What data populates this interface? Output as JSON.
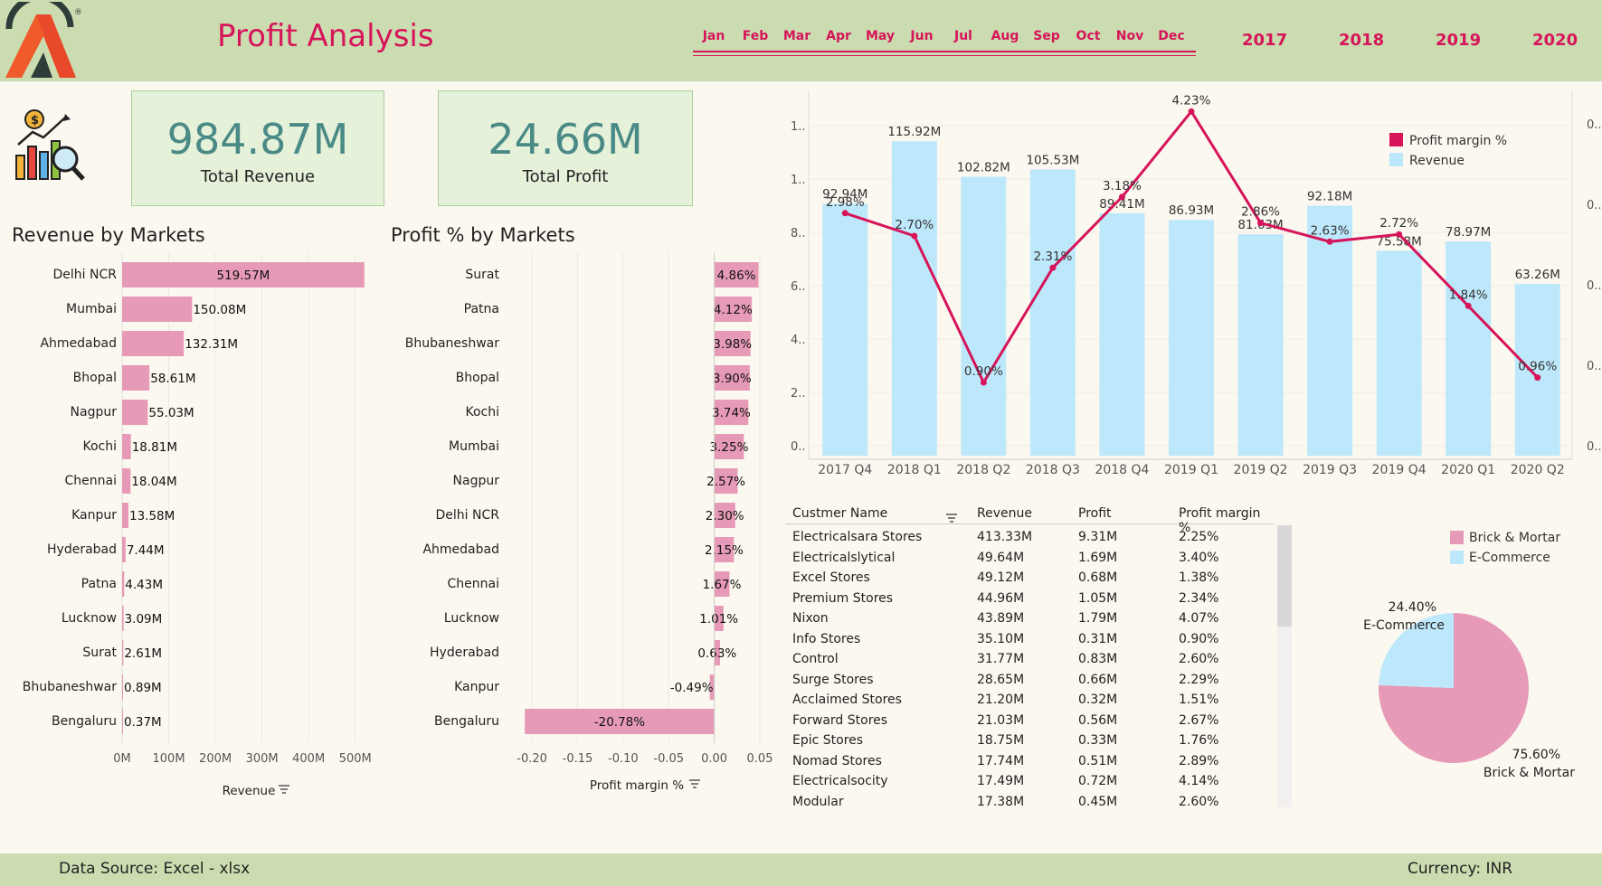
{
  "header": {
    "title": "Profit Analysis",
    "months": [
      "Jan",
      "Feb",
      "Mar",
      "Apr",
      "May",
      "Jun",
      "Jul",
      "Aug",
      "Sep",
      "Oct",
      "Nov",
      "Dec"
    ],
    "years": [
      "2017",
      "2018",
      "2019",
      "2020"
    ],
    "logo_mark": "®"
  },
  "kpis": {
    "revenue_value": "984.87M",
    "revenue_label": "Total Revenue",
    "profit_value": "24.66M",
    "profit_label": "Total Profit"
  },
  "sections": {
    "revenue_by_markets": "Revenue by Markets",
    "profit_by_markets": "Profit  % by Markets"
  },
  "footer": {
    "source": "Data Source:  Excel - xlsx",
    "currency": "Currency: INR"
  },
  "colors": {
    "accent": "#d6145a",
    "bar_pink": "#e79ab7",
    "bar_blue": "#bde8fb",
    "kpi_text": "#4a8a86",
    "header_bg": "#cbddb0"
  },
  "table": {
    "headers": [
      "Custmer Name",
      "Revenue",
      "Profit",
      "Profit margin %"
    ],
    "rows": [
      [
        "Electricalsara Stores",
        "413.33M",
        "9.31M",
        "2.25%"
      ],
      [
        "Electricalslytical",
        "49.64M",
        "1.69M",
        "3.40%"
      ],
      [
        "Excel Stores",
        "49.12M",
        "0.68M",
        "1.38%"
      ],
      [
        "Premium Stores",
        "44.96M",
        "1.05M",
        "2.34%"
      ],
      [
        "Nixon",
        "43.89M",
        "1.79M",
        "4.07%"
      ],
      [
        "Info Stores",
        "35.10M",
        "0.31M",
        "0.90%"
      ],
      [
        "Control",
        "31.77M",
        "0.83M",
        "2.60%"
      ],
      [
        "Surge Stores",
        "28.65M",
        "0.66M",
        "2.29%"
      ],
      [
        "Acclaimed Stores",
        "21.20M",
        "0.32M",
        "1.51%"
      ],
      [
        "Forward Stores",
        "21.03M",
        "0.56M",
        "2.67%"
      ],
      [
        "Epic Stores",
        "18.75M",
        "0.33M",
        "1.76%"
      ],
      [
        "Nomad Stores",
        "17.74M",
        "0.51M",
        "2.89%"
      ],
      [
        "Electricalsocity",
        "17.49M",
        "0.72M",
        "4.14%"
      ],
      [
        "Modular",
        "17.38M",
        "0.45M",
        "2.60%"
      ]
    ]
  },
  "chart_data": [
    {
      "type": "bar",
      "title": "Revenue by Markets",
      "orientation": "horizontal",
      "categories": [
        "Delhi NCR",
        "Mumbai",
        "Ahmedabad",
        "Bhopal",
        "Nagpur",
        "Kochi",
        "Chennai",
        "Kanpur",
        "Hyderabad",
        "Patna",
        "Lucknow",
        "Surat",
        "Bhubaneshwar",
        "Bengaluru"
      ],
      "values": [
        519.57,
        150.08,
        132.31,
        58.61,
        55.03,
        18.81,
        18.04,
        13.58,
        7.44,
        4.43,
        3.09,
        2.61,
        0.89,
        0.37
      ],
      "labels": [
        "519.57M",
        "150.08M",
        "132.31M",
        "58.61M",
        "55.03M",
        "18.81M",
        "18.04M",
        "13.58M",
        "7.44M",
        "4.43M",
        "3.09M",
        "2.61M",
        "0.89M",
        "0.37M"
      ],
      "xticks": [
        "0M",
        "100M",
        "200M",
        "300M",
        "400M",
        "500M"
      ],
      "xlim": [
        0,
        520
      ],
      "xlabel": "Revenue",
      "grid": true
    },
    {
      "type": "bar",
      "title": "Profit  % by Markets",
      "orientation": "horizontal",
      "categories": [
        "Surat",
        "Patna",
        "Bhubaneshwar",
        "Bhopal",
        "Kochi",
        "Mumbai",
        "Nagpur",
        "Delhi NCR",
        "Ahmedabad",
        "Chennai",
        "Lucknow",
        "Hyderabad",
        "Kanpur",
        "Bengaluru"
      ],
      "values": [
        0.0486,
        0.0412,
        0.0398,
        0.039,
        0.0374,
        0.0325,
        0.0257,
        0.023,
        0.0215,
        0.0167,
        0.0101,
        0.0063,
        -0.0049,
        -0.2078
      ],
      "labels": [
        "4.86%",
        "4.12%",
        "3.98%",
        "3.90%",
        "3.74%",
        "3.25%",
        "2.57%",
        "2.30%",
        "2.15%",
        "1.67%",
        "1.01%",
        "0.63%",
        "-0.49%",
        "-20.78%"
      ],
      "xticks": [
        "-0.20",
        "-0.15",
        "-0.10",
        "-0.05",
        "0.00",
        "0.05"
      ],
      "xlim": [
        -0.21,
        0.05
      ],
      "xlabel": "Profit margin %",
      "grid": true
    },
    {
      "type": "bar",
      "combo": "bar+line",
      "categories": [
        "2017 Q4",
        "2018 Q1",
        "2018 Q2",
        "2018 Q3",
        "2018 Q4",
        "2019 Q1",
        "2019 Q2",
        "2019 Q3",
        "2019 Q4",
        "2020 Q1",
        "2020 Q2"
      ],
      "series": [
        {
          "name": "Revenue",
          "type": "bar",
          "values": [
            92.94,
            115.92,
            102.82,
            105.53,
            89.41,
            86.93,
            81.63,
            92.18,
            75.58,
            78.97,
            63.26
          ],
          "labels": [
            "92.94M",
            "115.92M",
            "102.82M",
            "105.53M",
            "89.41M",
            "86.93M",
            "81.63M",
            "92.18M",
            "75.58M",
            "78.97M",
            "63.26M"
          ]
        },
        {
          "name": "Profit margin %",
          "type": "line",
          "values": [
            2.98,
            2.7,
            0.9,
            2.31,
            3.18,
            4.23,
            2.86,
            2.63,
            2.72,
            1.84,
            0.96
          ],
          "labels": [
            "2.98%",
            "2.70%",
            "0.90%",
            "2.31%",
            "3.18%",
            "4.23%",
            "2.86%",
            "2.63%",
            "2.72%",
            "1.84%",
            "0.96%"
          ]
        }
      ],
      "left_ticks": [
        "0..",
        "2..",
        "4..",
        "6..",
        "8..",
        "1..",
        "1.."
      ],
      "right_ticks": [
        "0..",
        "0..",
        "0..",
        "0..",
        "0..",
        "0.."
      ],
      "ylim_left": [
        0,
        132
      ],
      "ylim_right": [
        0,
        4.4
      ],
      "legend_position": "top-right",
      "grid": true
    },
    {
      "type": "pie",
      "categories": [
        "Brick & Mortar",
        "E-Commerce"
      ],
      "values": [
        75.6,
        24.4
      ],
      "labels": [
        "75.60%",
        "24.40%"
      ],
      "legend_position": "top-right"
    }
  ]
}
